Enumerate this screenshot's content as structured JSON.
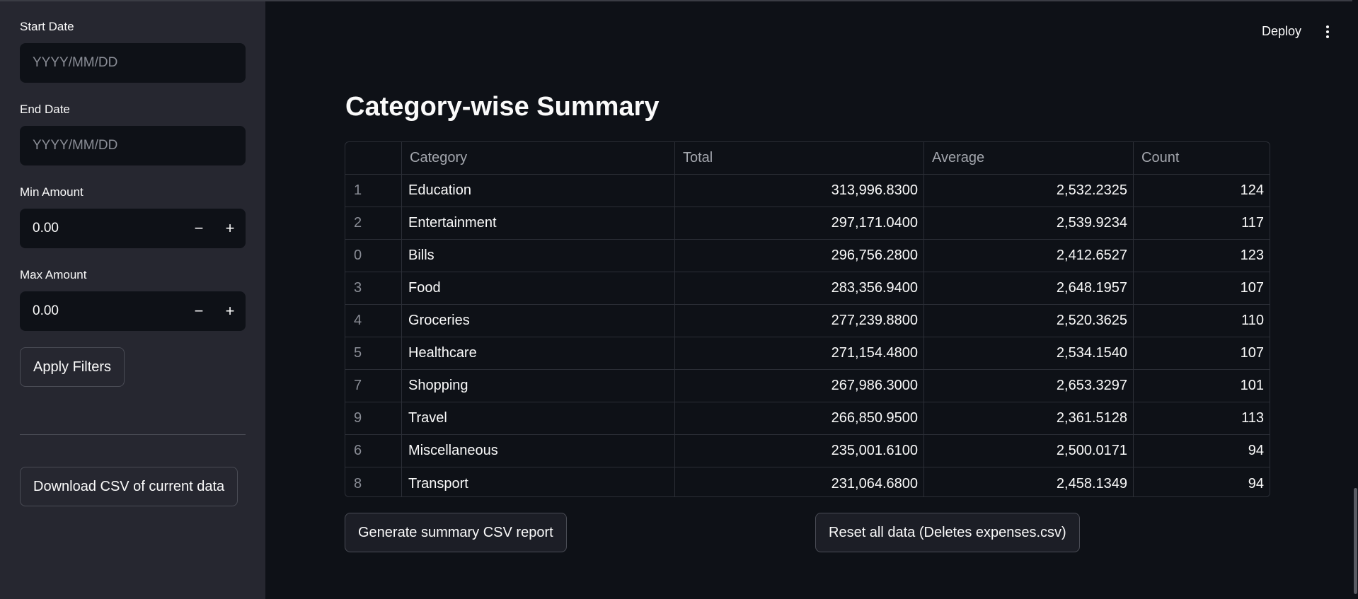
{
  "sidebar": {
    "start_date": {
      "label": "Start Date",
      "placeholder": "YYYY/MM/DD"
    },
    "end_date": {
      "label": "End Date",
      "placeholder": "YYYY/MM/DD"
    },
    "min_amount": {
      "label": "Min Amount",
      "value": "0.00",
      "minus": "−",
      "plus": "+"
    },
    "max_amount": {
      "label": "Max Amount",
      "value": "0.00",
      "minus": "−",
      "plus": "+"
    },
    "apply_label": "Apply Filters",
    "download_label": "Download CSV of current data"
  },
  "header": {
    "deploy_label": "Deploy",
    "menu_icon": "kebab-menu-icon"
  },
  "main": {
    "title": "Category-wise Summary",
    "table": {
      "columns": [
        "",
        "Category",
        "Total",
        "Average",
        "Count"
      ],
      "rows": [
        {
          "index": "1",
          "category": "Education",
          "total": "313,996.8300",
          "average": "2,532.2325",
          "count": "124"
        },
        {
          "index": "2",
          "category": "Entertainment",
          "total": "297,171.0400",
          "average": "2,539.9234",
          "count": "117"
        },
        {
          "index": "0",
          "category": "Bills",
          "total": "296,756.2800",
          "average": "2,412.6527",
          "count": "123"
        },
        {
          "index": "3",
          "category": "Food",
          "total": "283,356.9400",
          "average": "2,648.1957",
          "count": "107"
        },
        {
          "index": "4",
          "category": "Groceries",
          "total": "277,239.8800",
          "average": "2,520.3625",
          "count": "110"
        },
        {
          "index": "5",
          "category": "Healthcare",
          "total": "271,154.4800",
          "average": "2,534.1540",
          "count": "107"
        },
        {
          "index": "7",
          "category": "Shopping",
          "total": "267,986.3000",
          "average": "2,653.3297",
          "count": "101"
        },
        {
          "index": "9",
          "category": "Travel",
          "total": "266,850.9500",
          "average": "2,361.5128",
          "count": "113"
        },
        {
          "index": "6",
          "category": "Miscellaneous",
          "total": "235,001.6100",
          "average": "2,500.0171",
          "count": "94"
        },
        {
          "index": "8",
          "category": "Transport",
          "total": "231,064.6800",
          "average": "2,458.1349",
          "count": "94"
        }
      ]
    },
    "generate_label": "Generate summary CSV report",
    "reset_label": "Reset all data (Deletes expenses.csv)"
  }
}
